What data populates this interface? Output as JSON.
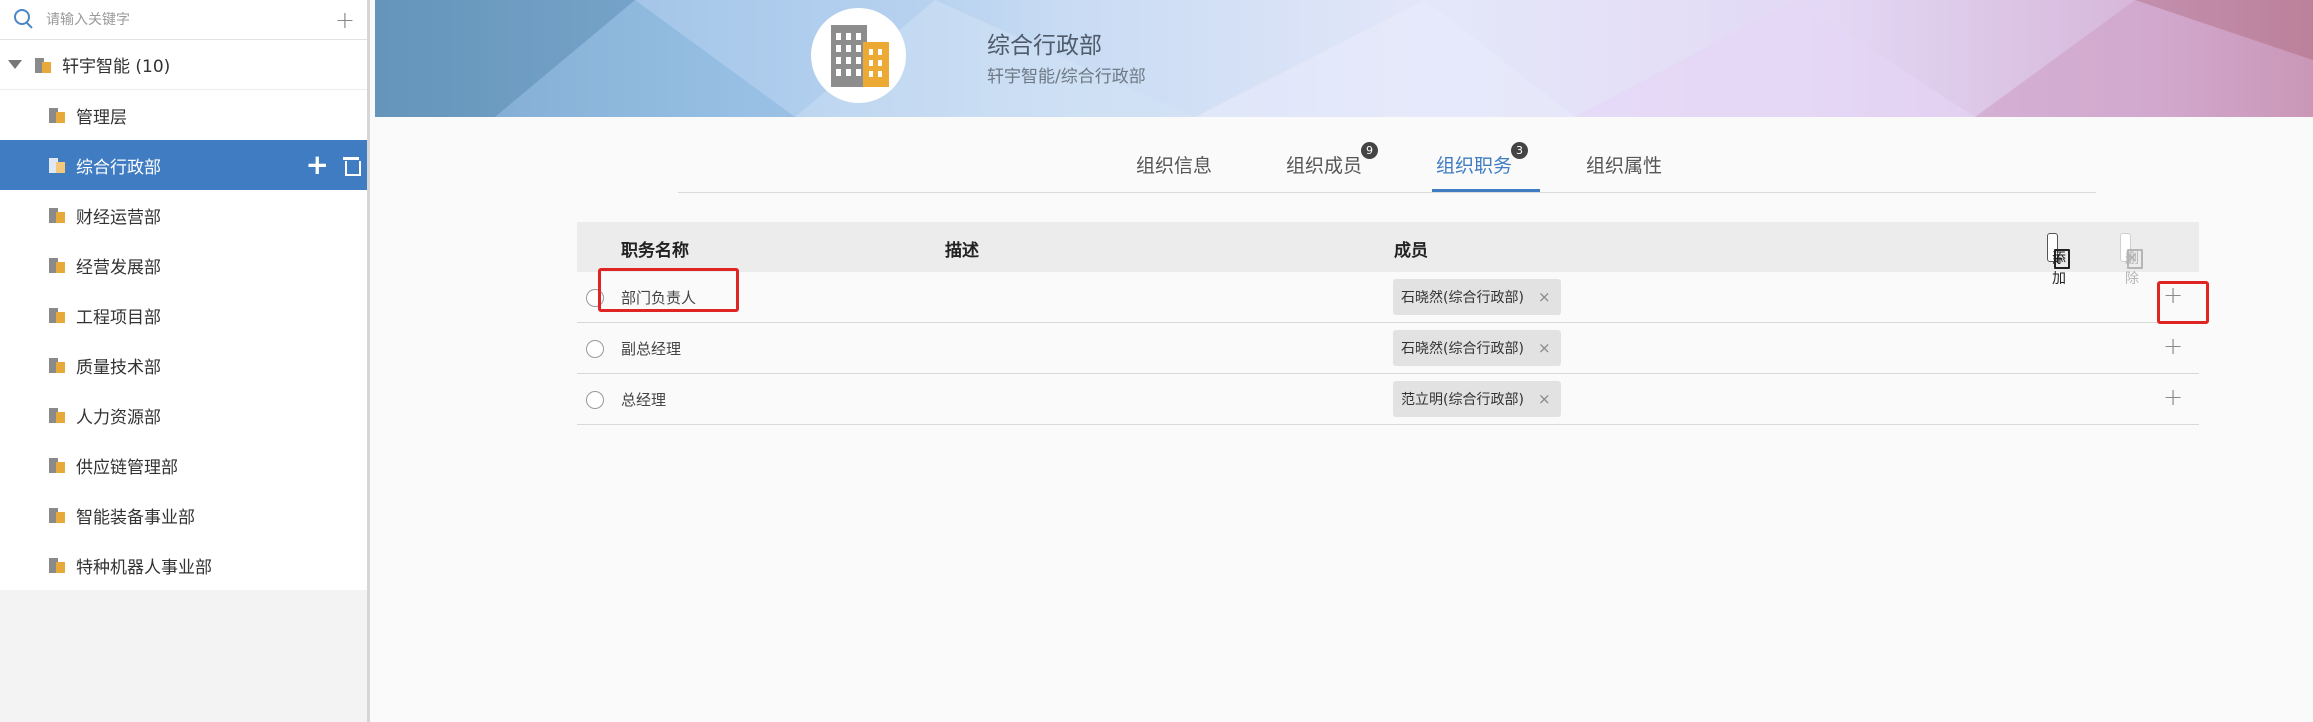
{
  "sidebar": {
    "search_placeholder": "请输入关键字",
    "add_icon": "plus-icon",
    "root": {
      "label": "轩宇智能 (10)"
    },
    "items": [
      {
        "label": "管理层",
        "active": false
      },
      {
        "label": "综合行政部",
        "active": true
      },
      {
        "label": "财经运营部",
        "active": false
      },
      {
        "label": "经营发展部",
        "active": false
      },
      {
        "label": "工程项目部",
        "active": false
      },
      {
        "label": "质量技术部",
        "active": false
      },
      {
        "label": "人力资源部",
        "active": false
      },
      {
        "label": "供应链管理部",
        "active": false
      },
      {
        "label": "智能装备事业部",
        "active": false
      },
      {
        "label": "特种机器人事业部",
        "active": false
      }
    ]
  },
  "header": {
    "title": "综合行政部",
    "path": "轩宇智能/综合行政部"
  },
  "tabs": [
    {
      "label": "组织信息",
      "badge": ""
    },
    {
      "label": "组织成员",
      "badge": "9"
    },
    {
      "label": "组织职务",
      "badge": "3"
    },
    {
      "label": "组织属性",
      "badge": ""
    }
  ],
  "active_tab": "组织职务",
  "table": {
    "columns": {
      "name": "职务名称",
      "desc": "描述",
      "members": "成员"
    },
    "add_label": "添加",
    "delete_label": "删除",
    "rows": [
      {
        "name": "部门负责人",
        "desc": "",
        "member": "石晓然(综合行政部)"
      },
      {
        "name": "副总经理",
        "desc": "",
        "member": "石晓然(综合行政部)"
      },
      {
        "name": "总经理",
        "desc": "",
        "member": "范立明(综合行政部)"
      }
    ],
    "remove_glyph": "×",
    "add_member_glyph": "+"
  },
  "colors": {
    "accent": "#3f7cc2",
    "highlight": "#e02424",
    "building_gray": "#8d8d8d",
    "building_orange": "#ecaa35"
  }
}
